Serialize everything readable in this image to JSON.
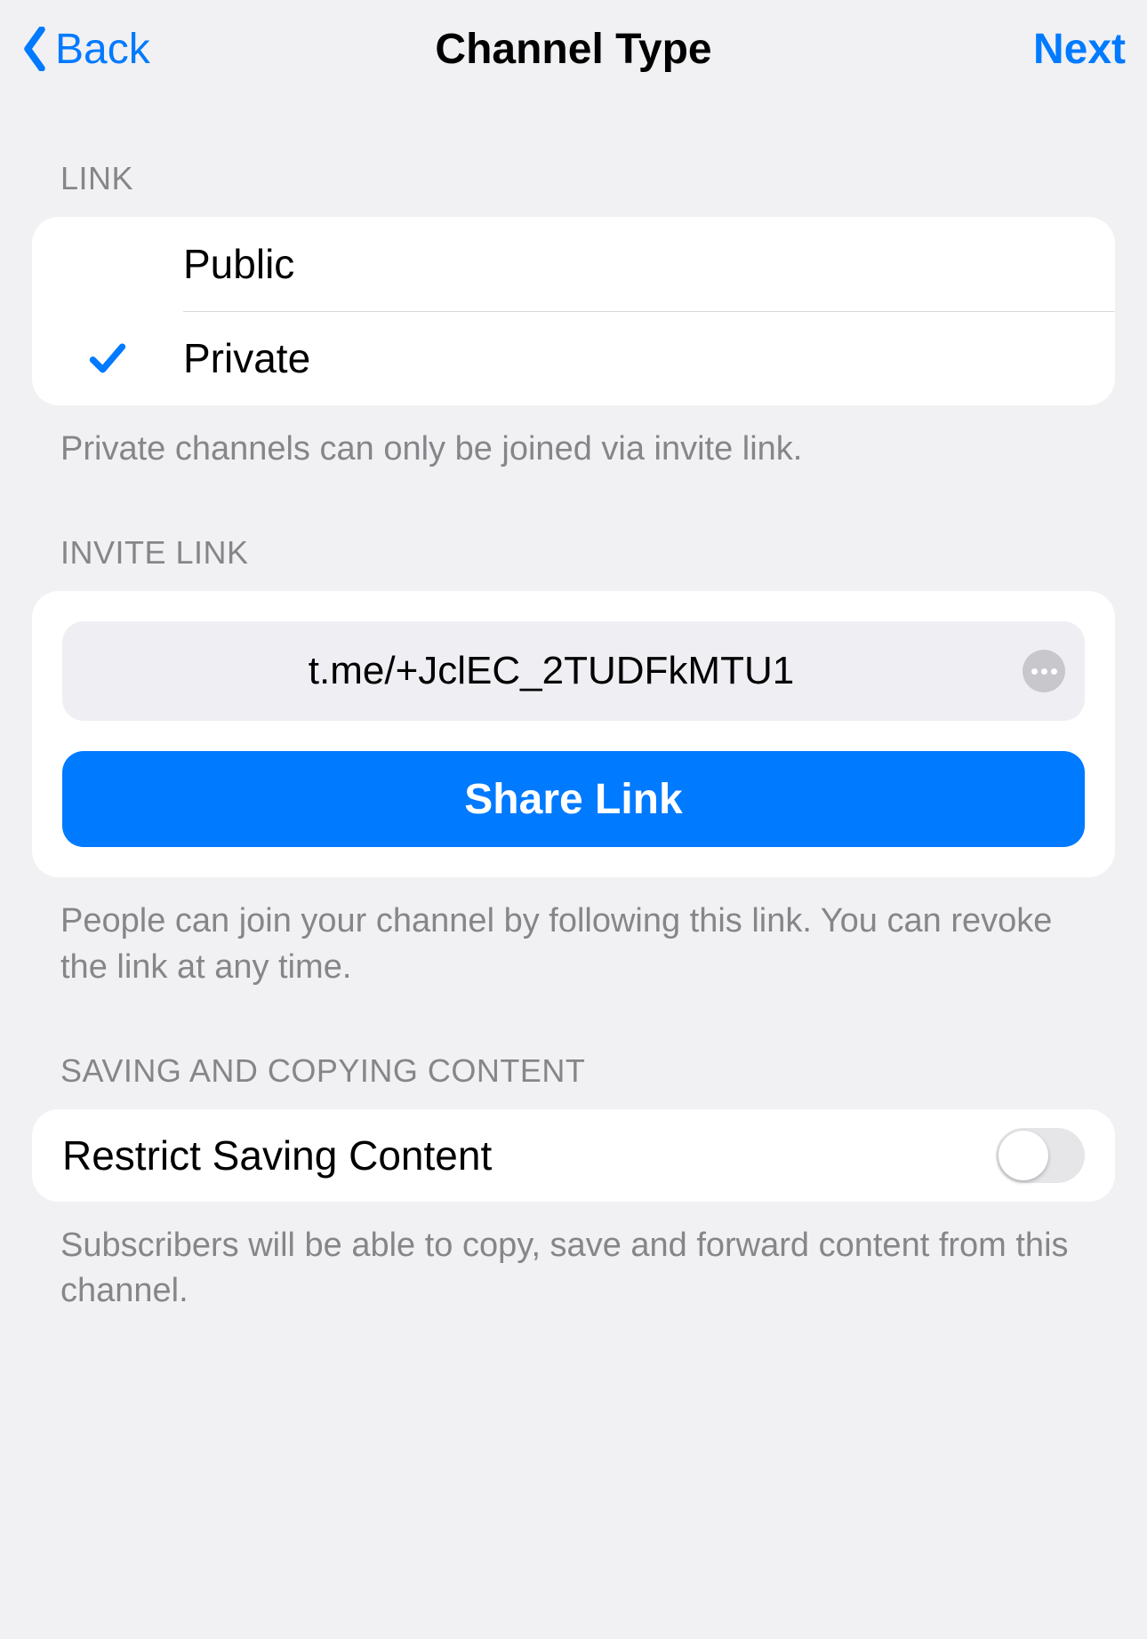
{
  "nav": {
    "back_label": "Back",
    "title": "Channel Type",
    "next_label": "Next"
  },
  "sections": {
    "link": {
      "header": "LINK",
      "options": {
        "public": "Public",
        "private": "Private"
      },
      "selected": "private",
      "footer": "Private channels can only be joined via invite link."
    },
    "invite": {
      "header": "INVITE LINK",
      "link_text": "t.me/+JclEC_2TUDFkMTU1",
      "share_label": "Share Link",
      "footer": "People can join your channel by following this link. You can revoke the link at any time."
    },
    "saving": {
      "header": "SAVING AND COPYING CONTENT",
      "restrict_label": "Restrict Saving Content",
      "restrict_enabled": false,
      "footer": "Subscribers will be able to copy, save and forward content from this channel."
    }
  }
}
